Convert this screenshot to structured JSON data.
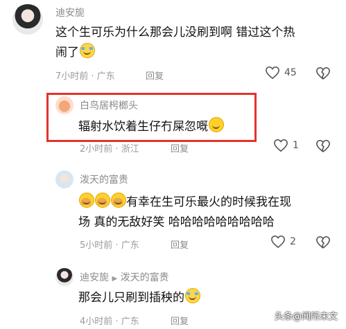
{
  "comments": [
    {
      "author": "迪安旎",
      "text_line1": "这个生可乐为什么那会儿没刷到啊 错过这个热",
      "text_line2": "闹了",
      "emoji": "laugh-cry-emoji",
      "time": "7小时前",
      "location": "广东",
      "reply_label": "回复",
      "likes": "45"
    },
    {
      "author": "白鸟居枵榔头",
      "text": "辐射水饮着生仔冇屎忽嘅",
      "emoji": "grin-emoji",
      "time": "2小时前",
      "location": "浙江",
      "reply_label": "回复",
      "likes": "1"
    },
    {
      "author": "泼天的富贵",
      "text_line1": "有幸在生可乐最火的时候我在现",
      "text_line2": "场  真的无敌好笑  哈哈哈哈哈哈哈哈哈",
      "emoji": "facepalm-emoji",
      "time": "5小时前",
      "location": "广东",
      "reply_label": "回复",
      "likes": "2"
    },
    {
      "author": "迪安旎",
      "reply_to": "泼天的富贵",
      "text": "那会儿只刷到插秧的",
      "emoji": "laugh-cry-emoji",
      "time": "4小时前",
      "location": "广东",
      "reply_label": "回复"
    }
  ],
  "separator": "·",
  "highlight_color": "#e5322b",
  "watermark": "头条@闻所未文"
}
